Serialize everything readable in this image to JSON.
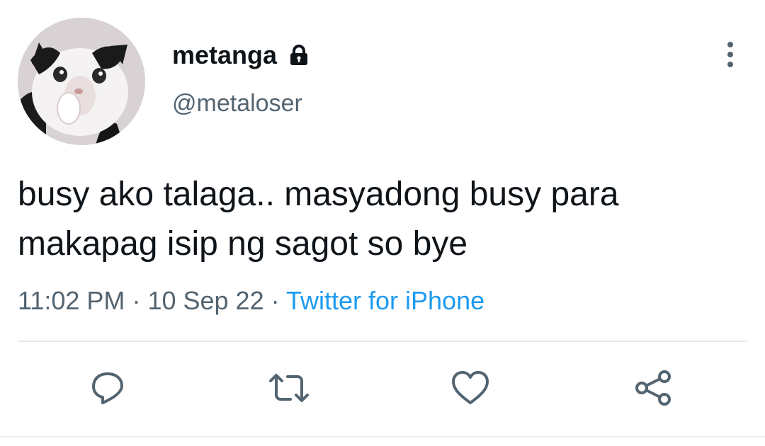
{
  "author": {
    "display_name": "metanga",
    "handle": "@metaloser",
    "protected": true,
    "avatar_icon": "cat-photo-avatar"
  },
  "tweet": {
    "text_lines": [
      "busy ako talaga.. masyadong busy para",
      "makapag isip ng sagot so bye"
    ],
    "time": "11:02 PM",
    "date": "10 Sep 22",
    "separator": "·",
    "source": "Twitter for iPhone"
  },
  "actions": [
    {
      "icon": "reply-icon"
    },
    {
      "icon": "retweet-icon"
    },
    {
      "icon": "like-icon"
    },
    {
      "icon": "share-icon"
    }
  ],
  "colors": {
    "text": "#0f1419",
    "secondary": "#536471",
    "link": "#1d9bf0",
    "icon": "#536471",
    "divider": "#e6e9ec"
  }
}
